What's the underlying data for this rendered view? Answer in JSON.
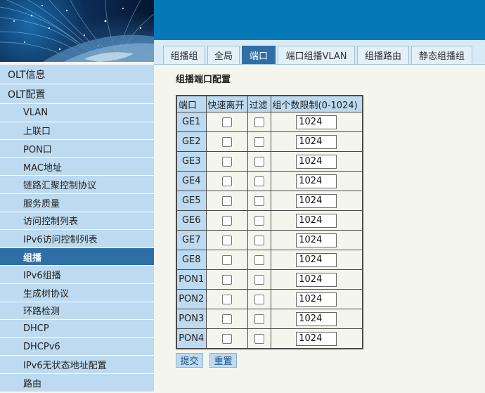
{
  "tabs": [
    {
      "label": "组播组",
      "active": false
    },
    {
      "label": "全局",
      "active": false
    },
    {
      "label": "端口",
      "active": true
    },
    {
      "label": "端口组播VLAN",
      "active": false
    },
    {
      "label": "组播路由",
      "active": false
    },
    {
      "label": "静态组播组",
      "active": false
    }
  ],
  "sidebar": {
    "items": [
      {
        "label": "OLT信息",
        "level": "top",
        "active": false
      },
      {
        "label": "OLT配置",
        "level": "top",
        "active": false
      },
      {
        "label": "VLAN",
        "level": "sub",
        "active": false
      },
      {
        "label": "上联口",
        "level": "sub",
        "active": false
      },
      {
        "label": "PON口",
        "level": "sub",
        "active": false
      },
      {
        "label": "MAC地址",
        "level": "sub",
        "active": false
      },
      {
        "label": "链路汇聚控制协议",
        "level": "sub",
        "active": false
      },
      {
        "label": "服务质量",
        "level": "sub",
        "active": false
      },
      {
        "label": "访问控制列表",
        "level": "sub",
        "active": false
      },
      {
        "label": "IPv6访问控制列表",
        "level": "sub",
        "active": false
      },
      {
        "label": "组播",
        "level": "sub",
        "active": true
      },
      {
        "label": "IPv6组播",
        "level": "sub",
        "active": false
      },
      {
        "label": "生成树协议",
        "level": "sub",
        "active": false
      },
      {
        "label": "环路检测",
        "level": "sub",
        "active": false
      },
      {
        "label": "DHCP",
        "level": "sub",
        "active": false
      },
      {
        "label": "DHCPv6",
        "level": "sub",
        "active": false
      },
      {
        "label": "IPv6无状态地址配置",
        "level": "sub",
        "active": false
      },
      {
        "label": "路由",
        "level": "sub",
        "active": false
      }
    ]
  },
  "main": {
    "title": "组播端口配置",
    "table": {
      "headers": [
        "端口",
        "快速离开",
        "过滤",
        "组个数限制(0-1024)"
      ],
      "rows": [
        {
          "port": "GE1",
          "fast_leave": false,
          "filter": false,
          "limit": "1024"
        },
        {
          "port": "GE2",
          "fast_leave": false,
          "filter": false,
          "limit": "1024"
        },
        {
          "port": "GE3",
          "fast_leave": false,
          "filter": false,
          "limit": "1024"
        },
        {
          "port": "GE4",
          "fast_leave": false,
          "filter": false,
          "limit": "1024"
        },
        {
          "port": "GE5",
          "fast_leave": false,
          "filter": false,
          "limit": "1024"
        },
        {
          "port": "GE6",
          "fast_leave": false,
          "filter": false,
          "limit": "1024"
        },
        {
          "port": "GE7",
          "fast_leave": false,
          "filter": false,
          "limit": "1024"
        },
        {
          "port": "GE8",
          "fast_leave": false,
          "filter": false,
          "limit": "1024"
        },
        {
          "port": "PON1",
          "fast_leave": false,
          "filter": false,
          "limit": "1024"
        },
        {
          "port": "PON2",
          "fast_leave": false,
          "filter": false,
          "limit": "1024"
        },
        {
          "port": "PON3",
          "fast_leave": false,
          "filter": false,
          "limit": "1024"
        },
        {
          "port": "PON4",
          "fast_leave": false,
          "filter": false,
          "limit": "1024"
        }
      ]
    },
    "submit_label": "提交",
    "reset_label": "重置"
  },
  "colors": {
    "banner_blue": "#0579b8",
    "sidebar_bg": "#bddaf0",
    "active_bg": "#2f6fa7",
    "page_bg": "#f4f6ee"
  }
}
